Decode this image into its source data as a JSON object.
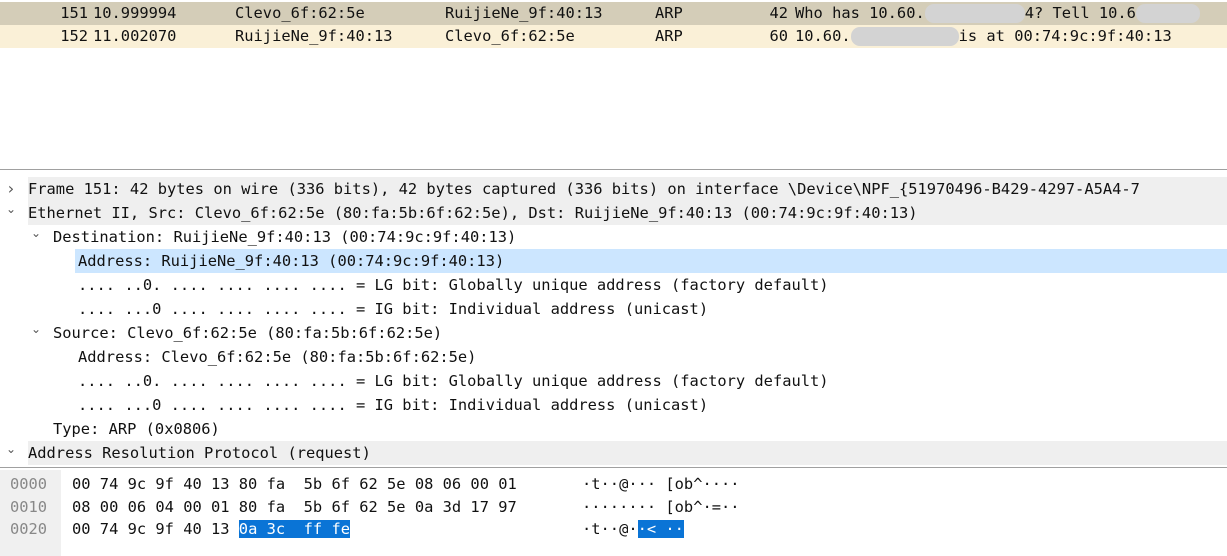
{
  "packet_list": {
    "rows": [
      {
        "no": "151",
        "time": "10.999994",
        "source": "Clevo_6f:62:5e",
        "destination": "RuijieNe_9f:40:13",
        "protocol": "ARP",
        "length": "42",
        "info_parts": [
          "Who has 10.60.",
          "",
          "4? Tell 10.6",
          "",
          ""
        ],
        "selected": true
      },
      {
        "no": "152",
        "time": "11.002070",
        "source": "RuijieNe_9f:40:13",
        "destination": "Clevo_6f:62:5e",
        "protocol": "ARP",
        "length": "60",
        "info_parts": [
          "10.60.",
          "",
          "is at 00:74:9c:9f:40:13"
        ],
        "selected": false
      }
    ],
    "colors": {
      "selected_bg": "#d4cdb8",
      "arp_bg": "#faf0d7"
    }
  },
  "details": [
    {
      "text": "Frame 151: 42 bytes on wire (336 bits), 42 bytes captured (336 bits) on interface \\Device\\NPF_{51970496-B429-4297-A5A4-7",
      "level": 0,
      "expander": "collapsed"
    },
    {
      "text": "Ethernet II, Src: Clevo_6f:62:5e (80:fa:5b:6f:62:5e), Dst: RuijieNe_9f:40:13 (00:74:9c:9f:40:13)",
      "level": 0,
      "expander": "expanded"
    },
    {
      "text": "Destination: RuijieNe_9f:40:13 (00:74:9c:9f:40:13)",
      "level": 1,
      "expander": "expanded"
    },
    {
      "text": "Address: RuijieNe_9f:40:13 (00:74:9c:9f:40:13)",
      "level": 2,
      "expander": "none",
      "selected": true
    },
    {
      "text": ".... ..0. .... .... .... .... = LG bit: Globally unique address (factory default)",
      "level": 2,
      "expander": "none"
    },
    {
      "text": ".... ...0 .... .... .... .... = IG bit: Individual address (unicast)",
      "level": 2,
      "expander": "none"
    },
    {
      "text": "Source: Clevo_6f:62:5e (80:fa:5b:6f:62:5e)",
      "level": 1,
      "expander": "expanded"
    },
    {
      "text": "Address: Clevo_6f:62:5e (80:fa:5b:6f:62:5e)",
      "level": 2,
      "expander": "none"
    },
    {
      "text": ".... ..0. .... .... .... .... = LG bit: Globally unique address (factory default)",
      "level": 2,
      "expander": "none"
    },
    {
      "text": ".... ...0 .... .... .... .... = IG bit: Individual address (unicast)",
      "level": 2,
      "expander": "none"
    },
    {
      "text": "Type: ARP (0x0806)",
      "level": 1,
      "expander": "none"
    },
    {
      "text": "Address Resolution Protocol (request)",
      "level": 0,
      "expander": "expanded"
    }
  ],
  "hex": [
    {
      "offset": "0000",
      "bytes": "00 74 9c 9f 40 13 80 fa  5b 6f 62 5e 08 06 00 01",
      "bytes_hl": "",
      "ascii": "·t··@··· [ob^····",
      "ascii_hl": ""
    },
    {
      "offset": "0010",
      "bytes": "08 00 06 04 00 01 80 fa  5b 6f 62 5e 0a 3d 17 97",
      "bytes_hl": "",
      "ascii": "········ [ob^·=··",
      "ascii_hl": ""
    },
    {
      "offset": "0020",
      "bytes": "00 74 9c 9f 40 13 ",
      "bytes_hl": "0a 3c  ff fe",
      "ascii": "·t··@·",
      "ascii_hl": "·< ··"
    }
  ],
  "colors": {
    "selection": "#0a74d6",
    "detail_selection": "#cce6ff"
  }
}
